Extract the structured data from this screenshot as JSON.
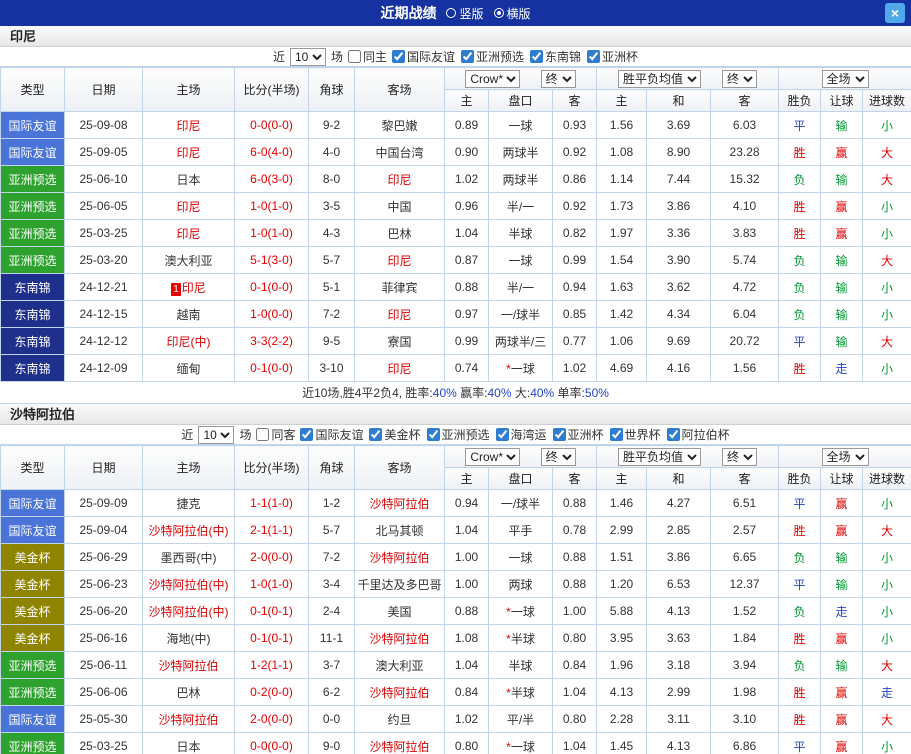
{
  "titlebar": {
    "title": "近期战绩",
    "vertical": "竖版",
    "horizontal": "横版",
    "selected": "横版",
    "close": "×"
  },
  "filter": {
    "near": "近",
    "count": "10",
    "games": "场"
  },
  "columns": {
    "type": "类型",
    "date": "日期",
    "home": "主场",
    "score": "比分(半场)",
    "corner": "角球",
    "away": "客场",
    "odds_company": "Crow*",
    "final_label": "终",
    "euro_label": "胜平负均值",
    "scope_label": "全场",
    "ah_home": "主",
    "handicap": "盘口",
    "ah_away": "客",
    "euro_home": "主",
    "euro_draw": "和",
    "euro_away": "客",
    "result_wdl": "胜负",
    "result_handicap": "让球",
    "result_goals": "进球数"
  },
  "type_colors": {
    "国际友谊": "#4a74d8",
    "亚洲预选": "#2ea22e",
    "东南锦": "#1e2f8c",
    "美金杯": "#8f8400"
  },
  "result_colors": {
    "胜": "r-win",
    "赢": "r-win",
    "大": "r-win",
    "负": "r-lose",
    "输": "r-lose",
    "小": "r-lose",
    "平": "r-draw",
    "走": "r-draw"
  },
  "colors": {
    "accent_blue": "#1532a0",
    "focus_team": "#dc0000",
    "score_red": "#e60000",
    "win_red": "#e60000",
    "lose_green": "#009933",
    "draw_blue": "#2643c8"
  },
  "sections": [
    {
      "team": "印尼",
      "same_label": "同主",
      "comps": [
        "国际友谊",
        "亚洲预选",
        "东南锦",
        "亚洲杯"
      ],
      "rows": [
        {
          "type": "国际友谊",
          "date": "25-09-08",
          "home": "印尼",
          "home_focus": true,
          "score": "0-0(0-0)",
          "corner": "9-2",
          "away": "黎巴嫩",
          "away_focus": false,
          "ah": [
            "0.89",
            "一球",
            "0.93"
          ],
          "odds": [
            "1.56",
            "3.69",
            "6.03"
          ],
          "res": [
            "平",
            "输",
            "小"
          ]
        },
        {
          "type": "国际友谊",
          "date": "25-09-05",
          "home": "印尼",
          "home_focus": true,
          "score": "6-0(4-0)",
          "corner": "4-0",
          "away": "中国台湾",
          "away_focus": false,
          "ah": [
            "0.90",
            "两球半",
            "0.92"
          ],
          "odds": [
            "1.08",
            "8.90",
            "23.28"
          ],
          "res": [
            "胜",
            "赢",
            "大"
          ]
        },
        {
          "type": "亚洲预选",
          "date": "25-06-10",
          "home": "日本",
          "home_focus": false,
          "score": "6-0(3-0)",
          "corner": "8-0",
          "away": "印尼",
          "away_focus": true,
          "ah": [
            "1.02",
            "两球半",
            "0.86"
          ],
          "odds": [
            "1.14",
            "7.44",
            "15.32"
          ],
          "res": [
            "负",
            "输",
            "大"
          ]
        },
        {
          "type": "亚洲预选",
          "date": "25-06-05",
          "home": "印尼",
          "home_focus": true,
          "score": "1-0(1-0)",
          "corner": "3-5",
          "away": "中国",
          "away_focus": false,
          "ah": [
            "0.96",
            "半/一",
            "0.92"
          ],
          "odds": [
            "1.73",
            "3.86",
            "4.10"
          ],
          "res": [
            "胜",
            "赢",
            "小"
          ]
        },
        {
          "type": "亚洲预选",
          "date": "25-03-25",
          "home": "印尼",
          "home_focus": true,
          "score": "1-0(1-0)",
          "corner": "4-3",
          "away": "巴林",
          "away_focus": false,
          "ah": [
            "1.04",
            "半球",
            "0.82"
          ],
          "odds": [
            "1.97",
            "3.36",
            "3.83"
          ],
          "res": [
            "胜",
            "赢",
            "小"
          ]
        },
        {
          "type": "亚洲预选",
          "date": "25-03-20",
          "home": "澳大利亚",
          "home_focus": false,
          "score": "5-1(3-0)",
          "corner": "5-7",
          "away": "印尼",
          "away_focus": true,
          "ah": [
            "0.87",
            "一球",
            "0.99"
          ],
          "odds": [
            "1.54",
            "3.90",
            "5.74"
          ],
          "res": [
            "负",
            "输",
            "大"
          ]
        },
        {
          "type": "东南锦",
          "date": "24-12-21",
          "home": "印尼",
          "home_focus": true,
          "home_badge": "1",
          "score": "0-1(0-0)",
          "corner": "5-1",
          "away": "菲律宾",
          "away_focus": false,
          "ah": [
            "0.88",
            "半/一",
            "0.94"
          ],
          "odds": [
            "1.63",
            "3.62",
            "4.72"
          ],
          "res": [
            "负",
            "输",
            "小"
          ]
        },
        {
          "type": "东南锦",
          "date": "24-12-15",
          "home": "越南",
          "home_focus": false,
          "score": "1-0(0-0)",
          "corner": "7-2",
          "away": "印尼",
          "away_focus": true,
          "ah": [
            "0.97",
            "一/球半",
            "0.85"
          ],
          "odds": [
            "1.42",
            "4.34",
            "6.04"
          ],
          "res": [
            "负",
            "输",
            "小"
          ]
        },
        {
          "type": "东南锦",
          "date": "24-12-12",
          "home": "印尼(中)",
          "home_focus": true,
          "score": "3-3(2-2)",
          "corner": "9-5",
          "away": "寮国",
          "away_focus": false,
          "ah": [
            "0.99",
            "两球半/三",
            "0.77"
          ],
          "odds": [
            "1.06",
            "9.69",
            "20.72"
          ],
          "res": [
            "平",
            "输",
            "大"
          ]
        },
        {
          "type": "东南锦",
          "date": "24-12-09",
          "home": "缅甸",
          "home_focus": false,
          "score": "0-1(0-0)",
          "corner": "3-10",
          "away": "印尼",
          "away_focus": true,
          "ah": [
            "0.74",
            "*一球",
            "1.02"
          ],
          "odds": [
            "4.69",
            "4.16",
            "1.56"
          ],
          "res": [
            "胜",
            "走",
            "小"
          ]
        }
      ],
      "summary_parts": [
        {
          "text": "近10场,胜4平2负4, 胜率:"
        },
        {
          "text": "40%",
          "color": "#2643c8"
        },
        {
          "text": " 赢率:"
        },
        {
          "text": "40%",
          "color": "#2643c8"
        },
        {
          "text": " 大:"
        },
        {
          "text": "40%",
          "color": "#2643c8"
        },
        {
          "text": " 单率:"
        },
        {
          "text": "50%",
          "color": "#2643c8"
        }
      ]
    },
    {
      "team": "沙特阿拉伯",
      "same_label": "同客",
      "comps": [
        "国际友谊",
        "美金杯",
        "亚洲预选",
        "海湾运",
        "亚洲杯",
        "世界杯",
        "阿拉伯杯"
      ],
      "rows": [
        {
          "type": "国际友谊",
          "date": "25-09-09",
          "home": "捷克",
          "home_focus": false,
          "score": "1-1(1-0)",
          "corner": "1-2",
          "away": "沙特阿拉伯",
          "away_focus": true,
          "ah": [
            "0.94",
            "一/球半",
            "0.88"
          ],
          "odds": [
            "1.46",
            "4.27",
            "6.51"
          ],
          "res": [
            "平",
            "赢",
            "小"
          ]
        },
        {
          "type": "国际友谊",
          "date": "25-09-04",
          "home": "沙特阿拉伯(中)",
          "home_focus": true,
          "score": "2-1(1-1)",
          "corner": "5-7",
          "away": "北马其顿",
          "away_focus": false,
          "ah": [
            "1.04",
            "平手",
            "0.78"
          ],
          "odds": [
            "2.99",
            "2.85",
            "2.57"
          ],
          "res": [
            "胜",
            "赢",
            "大"
          ]
        },
        {
          "type": "美金杯",
          "date": "25-06-29",
          "home": "墨西哥(中)",
          "home_focus": false,
          "score": "2-0(0-0)",
          "corner": "7-2",
          "away": "沙特阿拉伯",
          "away_focus": true,
          "ah": [
            "1.00",
            "一球",
            "0.88"
          ],
          "odds": [
            "1.51",
            "3.86",
            "6.65"
          ],
          "res": [
            "负",
            "输",
            "小"
          ]
        },
        {
          "type": "美金杯",
          "date": "25-06-23",
          "home": "沙特阿拉伯(中)",
          "home_focus": true,
          "score": "1-0(1-0)",
          "corner": "3-4",
          "away": "千里达及多巴哥",
          "away_focus": false,
          "ah": [
            "1.00",
            "两球",
            "0.88"
          ],
          "odds": [
            "1.20",
            "6.53",
            "12.37"
          ],
          "res": [
            "平",
            "输",
            "小"
          ]
        },
        {
          "type": "美金杯",
          "date": "25-06-20",
          "home": "沙特阿拉伯(中)",
          "home_focus": true,
          "score": "0-1(0-1)",
          "corner": "2-4",
          "away": "美国",
          "away_focus": false,
          "ah": [
            "0.88",
            "*一球",
            "1.00"
          ],
          "odds": [
            "5.88",
            "4.13",
            "1.52"
          ],
          "res": [
            "负",
            "走",
            "小"
          ]
        },
        {
          "type": "美金杯",
          "date": "25-06-16",
          "home": "海地(中)",
          "home_focus": false,
          "score": "0-1(0-1)",
          "corner": "11-1",
          "away": "沙特阿拉伯",
          "away_focus": true,
          "ah": [
            "1.08",
            "*半球",
            "0.80"
          ],
          "odds": [
            "3.95",
            "3.63",
            "1.84"
          ],
          "res": [
            "胜",
            "赢",
            "小"
          ]
        },
        {
          "type": "亚洲预选",
          "date": "25-06-11",
          "home": "沙特阿拉伯",
          "home_focus": true,
          "score": "1-2(1-1)",
          "corner": "3-7",
          "away": "澳大利亚",
          "away_focus": false,
          "ah": [
            "1.04",
            "半球",
            "0.84"
          ],
          "odds": [
            "1.96",
            "3.18",
            "3.94"
          ],
          "res": [
            "负",
            "输",
            "大"
          ]
        },
        {
          "type": "亚洲预选",
          "date": "25-06-06",
          "home": "巴林",
          "home_focus": false,
          "score": "0-2(0-0)",
          "corner": "6-2",
          "away": "沙特阿拉伯",
          "away_focus": true,
          "ah": [
            "0.84",
            "*半球",
            "1.04"
          ],
          "odds": [
            "4.13",
            "2.99",
            "1.98"
          ],
          "res": [
            "胜",
            "赢",
            "走"
          ]
        },
        {
          "type": "国际友谊",
          "date": "25-05-30",
          "home": "沙特阿拉伯",
          "home_focus": true,
          "score": "2-0(0-0)",
          "corner": "0-0",
          "away": "约旦",
          "away_focus": false,
          "ah": [
            "1.02",
            "平/半",
            "0.80"
          ],
          "odds": [
            "2.28",
            "3.11",
            "3.10"
          ],
          "res": [
            "胜",
            "赢",
            "大"
          ]
        },
        {
          "type": "亚洲预选",
          "date": "25-03-25",
          "home": "日本",
          "home_focus": false,
          "score": "0-0(0-0)",
          "corner": "9-0",
          "away": "沙特阿拉伯",
          "away_focus": true,
          "ah": [
            "0.80",
            "*一球",
            "1.04"
          ],
          "odds": [
            "1.45",
            "4.13",
            "6.86"
          ],
          "res": [
            "平",
            "赢",
            "小"
          ]
        }
      ]
    }
  ]
}
